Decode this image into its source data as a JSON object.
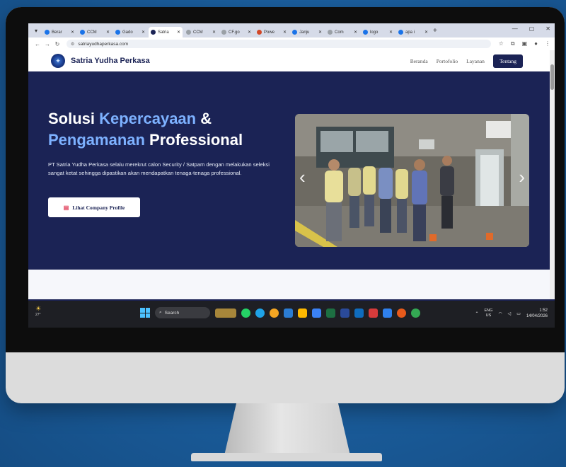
{
  "browser": {
    "tabs": [
      {
        "label": "Berar",
        "color": "#1a73e8"
      },
      {
        "label": "CCM",
        "color": "#1a73e8"
      },
      {
        "label": "Gado",
        "color": "#1a73e8"
      },
      {
        "label": "Satria",
        "color": "#1b2355",
        "active": true
      },
      {
        "label": "CCM",
        "color": "#9aa0a6"
      },
      {
        "label": "CF.go",
        "color": "#9aa0a6"
      },
      {
        "label": "Powe",
        "color": "#d24726"
      },
      {
        "label": "Janju",
        "color": "#1a73e8"
      },
      {
        "label": "Com",
        "color": "#9aa0a6"
      },
      {
        "label": "logo",
        "color": "#1a73e8"
      },
      {
        "label": "apa i",
        "color": "#1a73e8"
      }
    ],
    "url": "satriayudhaperkasa.com"
  },
  "site": {
    "brand": "Satria Yudha Perkasa",
    "nav": {
      "beranda": "Beranda",
      "portofolio": "Portofolio",
      "layanan": "Layanan",
      "tentang": "Tentang"
    },
    "hero": {
      "title_part1": "Solusi ",
      "title_highlight1": "Kepercayaan",
      "title_part2": " &",
      "title_highlight2": "Pengamanan",
      "title_part3": " Professional",
      "description": "PT Satria Yudha Perkasa selalu merekrut calon Security / Satpam dengan melakukan seleksi sangat ketat sehingga dipastikan akan mendapatkan tenaga-tenaga professional.",
      "button_label": "Lihat Company Profile"
    },
    "carousel": {
      "prev": "‹",
      "next": "›"
    }
  },
  "taskbar": {
    "search_label": "Search",
    "weather_temp": "27°",
    "lang_top": "ENG",
    "lang_bottom": "US",
    "time": "1:52",
    "date": "14/04/2026"
  },
  "colors": {
    "hero_bg": "#1b2355",
    "accent_text": "#7db1ff",
    "nav_cta_bg": "#1b2355"
  }
}
